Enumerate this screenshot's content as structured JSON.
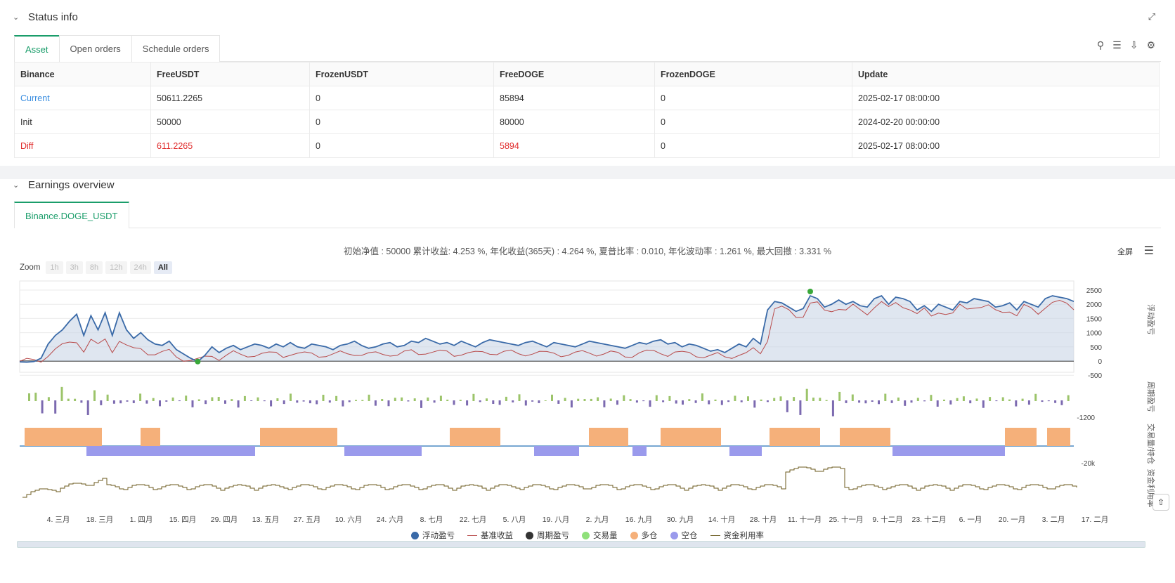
{
  "status": {
    "title": "Status info",
    "tabs": [
      "Asset",
      "Open orders",
      "Schedule orders"
    ],
    "columns": [
      "Binance",
      "FreeUSDT",
      "FrozenUSDT",
      "FreeDOGE",
      "FrozenDOGE",
      "Update"
    ],
    "rows": [
      [
        "Current",
        "50611.2265",
        "0",
        "85894",
        "0",
        "2025-02-17 08:00:00"
      ],
      [
        "Init",
        "50000",
        "0",
        "80000",
        "0",
        "2024-02-20 00:00:00"
      ],
      [
        "Diff",
        "611.2265",
        "0",
        "5894",
        "0",
        "2025-02-17 08:00:00"
      ]
    ]
  },
  "earnings": {
    "title": "Earnings overview",
    "tab": "Binance.DOGE_USDT",
    "summary": "初始净值 : 50000 累计收益: 4.253 %, 年化收益(365天) : 4.264 %, 夏普比率 : 0.010, 年化波动率 : 1.261 %, 最大回撤 : 3.331 %",
    "fullscreen": "全屏",
    "zoom_label": "Zoom",
    "zoom_buttons": [
      "1h",
      "3h",
      "8h",
      "12h",
      "24h",
      "All"
    ]
  },
  "icons": [
    "search-icon",
    "list-icon",
    "download-icon",
    "gear-icon",
    "expand-icon",
    "menu-icon"
  ],
  "chart_data": {
    "type": "line",
    "x_ticks": [
      "4. 三月",
      "18. 三月",
      "1. 四月",
      "15. 四月",
      "29. 四月",
      "13. 五月",
      "27. 五月",
      "10. 六月",
      "24. 六月",
      "8. 七月",
      "22. 七月",
      "5. 八月",
      "19. 八月",
      "2. 九月",
      "16. 九月",
      "30. 九月",
      "14. 十月",
      "28. 十月",
      "11. 十一月",
      "25. 十一月",
      "9. 十二月",
      "23. 十二月",
      "6. 一月",
      "20. 一月",
      "3. 二月",
      "17. 二月"
    ],
    "y_ticks": [
      "2500",
      "2000",
      "1500",
      "1000",
      "500",
      "0",
      "-500"
    ],
    "pane_labels": [
      "浮动盈亏",
      "周期盈亏",
      "交易量/持仓",
      "资金利用率"
    ],
    "pane2_min": "-1200",
    "pane3_min": "-20k",
    "pane4_min": "0",
    "series": [
      {
        "name": "浮动盈亏",
        "color": "#3a6aa8"
      },
      {
        "name": "基准收益",
        "color": "#b84a4a"
      },
      {
        "name": "周期盈亏",
        "color": "#333333"
      },
      {
        "name": "交易量",
        "color": "#8fe07a"
      },
      {
        "name": "多仓",
        "color": "#f5b07a"
      },
      {
        "name": "空仓",
        "color": "#9a9aec"
      },
      {
        "name": "资金利用率",
        "color": "#6b5a1e"
      }
    ],
    "float_pnl": [
      -30,
      -40,
      -20,
      100,
      600,
      900,
      1100,
      1400,
      1650,
      900,
      1600,
      1100,
      1700,
      900,
      1700,
      1100,
      800,
      1000,
      750,
      600,
      550,
      700,
      400,
      250,
      100,
      -20,
      200,
      500,
      300,
      450,
      550,
      400,
      500,
      600,
      550,
      450,
      600,
      500,
      650,
      500,
      450,
      600,
      550,
      500,
      400,
      550,
      600,
      700,
      550,
      450,
      500,
      600,
      650,
      500,
      550,
      700,
      650,
      800,
      700,
      600,
      650,
      550,
      700,
      600,
      500,
      650,
      750,
      700,
      650,
      600,
      550,
      650,
      700,
      600,
      500,
      650,
      600,
      550,
      500,
      600,
      700,
      650,
      600,
      550,
      500,
      450,
      550,
      650,
      600,
      700,
      750,
      600,
      650,
      500,
      600,
      550,
      450,
      350,
      400,
      300,
      450,
      600,
      500,
      800,
      600,
      1800,
      2100,
      2050,
      1900,
      1750,
      1850,
      2300,
      2200,
      1900,
      2000,
      2150,
      2000,
      2100,
      1950,
      1900,
      2200,
      2300,
      2000,
      2250,
      2200,
      2100,
      1800,
      1950,
      1750,
      2000,
      1900,
      1800,
      2100,
      2050,
      2200,
      2150,
      2100,
      1900,
      1950,
      2050,
      1800,
      2100,
      2000,
      1900,
      2200,
      2300,
      2250,
      2200,
      2100
    ]
  }
}
